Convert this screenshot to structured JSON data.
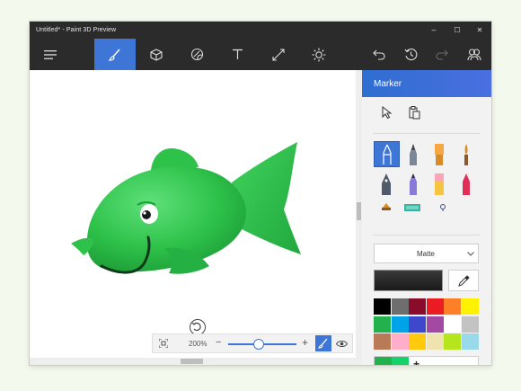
{
  "window": {
    "title": "Untitled* - Paint 3D Preview"
  },
  "title_controls": {
    "minimize": "–",
    "maximize": "☐",
    "close": "✕"
  },
  "toolbar": {
    "items": [
      {
        "icon": "menu-icon"
      },
      {
        "icon": "brush-icon",
        "active": true
      },
      {
        "icon": "3d-cube-icon"
      },
      {
        "icon": "sticker-icon"
      },
      {
        "icon": "text-icon"
      },
      {
        "icon": "resize-canvas-icon"
      },
      {
        "icon": "effects-sun-icon"
      },
      {
        "icon": "undo-icon"
      },
      {
        "icon": "history-icon"
      },
      {
        "icon": "redo-icon"
      },
      {
        "icon": "community-icon"
      }
    ]
  },
  "side_panel": {
    "title": "Marker",
    "finish": "Matte",
    "color_current": "#222222",
    "palette": [
      "#000000",
      "#6e6e6e",
      "#8b0c2a",
      "#ec1c24",
      "#ff7f27",
      "#fff200",
      "#22b14c",
      "#00a2e8",
      "#3f48cc",
      "#a349a4",
      "#ffffff",
      "#c3c3c3",
      "#b97a57",
      "#ffaec9",
      "#ffc90e",
      "#efe4b0",
      "#b5e61d",
      "#99d9ea"
    ],
    "custom_colors": [
      "#22b14c",
      "#15d36a"
    ],
    "add_color": "+"
  },
  "zoom": {
    "value": "200%",
    "percent": 45,
    "minus": "−",
    "plus": "+"
  },
  "colors": {
    "titlebar": "#2b2b2b",
    "accent": "#3e76d8",
    "fish": "#2ec24a"
  }
}
